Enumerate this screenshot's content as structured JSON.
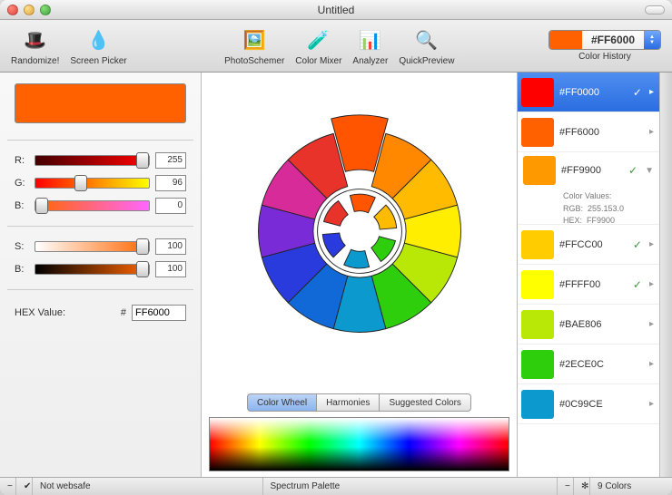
{
  "window": {
    "title": "Untitled"
  },
  "toolbar": {
    "randomize": "Randomize!",
    "screenpicker": "Screen Picker",
    "photoschemer": "PhotoSchemer",
    "colormixer": "Color Mixer",
    "analyzer": "Analyzer",
    "quickpreview": "QuickPreview",
    "history_label": "Color History",
    "current_hex": "#FF6000",
    "current_color": "#FF6000"
  },
  "swatch": {
    "color": "#FF6000"
  },
  "rgb": {
    "r_label": "R:",
    "r_val": "255",
    "g_label": "G:",
    "g_val": "96",
    "b_label": "B:",
    "b_val": "0"
  },
  "sb": {
    "s_label": "S:",
    "s_val": "100",
    "b_label": "B:",
    "b_val": "100"
  },
  "hex": {
    "label": "HEX Value:",
    "hash": "#",
    "val": "FF6000"
  },
  "tabs": {
    "wheel": "Color Wheel",
    "harmonies": "Harmonies",
    "suggested": "Suggested Colors"
  },
  "history": [
    {
      "hex": "#FF0000",
      "color": "#FF0000",
      "checked": true,
      "selected": true,
      "expanded": false
    },
    {
      "hex": "#FF6000",
      "color": "#FF6000",
      "checked": false,
      "selected": false,
      "expanded": false
    },
    {
      "hex": "#FF9900",
      "color": "#FF9900",
      "checked": true,
      "selected": false,
      "expanded": true,
      "rgb": "255.153.0",
      "hexv": "FF9900"
    },
    {
      "hex": "#FFCC00",
      "color": "#FFCC00",
      "checked": true,
      "selected": false,
      "expanded": false
    },
    {
      "hex": "#FFFF00",
      "color": "#FFFF00",
      "checked": true,
      "selected": false,
      "expanded": false
    },
    {
      "hex": "#BAE806",
      "color": "#BAE806",
      "checked": false,
      "selected": false,
      "expanded": false
    },
    {
      "hex": "#2ECE0C",
      "color": "#2ECE0C",
      "checked": false,
      "selected": false,
      "expanded": false
    },
    {
      "hex": "#0C99CE",
      "color": "#0C99CE",
      "checked": false,
      "selected": false,
      "expanded": false
    }
  ],
  "details": {
    "title": "Color Values:",
    "rgb_label": "RGB:",
    "hex_label": "HEX:"
  },
  "status": {
    "websafe": "Not websafe",
    "palette": "Spectrum Palette",
    "count": "9 Colors"
  },
  "wheel_colors": [
    "#FF5500",
    "#FF8800",
    "#FFBB00",
    "#FFEE00",
    "#BAE806",
    "#2ECE0C",
    "#0C99CE",
    "#1169D8",
    "#2A3BDD",
    "#7A2BD8",
    "#D82B9A",
    "#E8332B"
  ],
  "inner_colors": [
    "#FF5500",
    "#FFBB00",
    "#2ECE0C",
    "#0C99CE",
    "#2A3BDD",
    "#E8332B"
  ]
}
